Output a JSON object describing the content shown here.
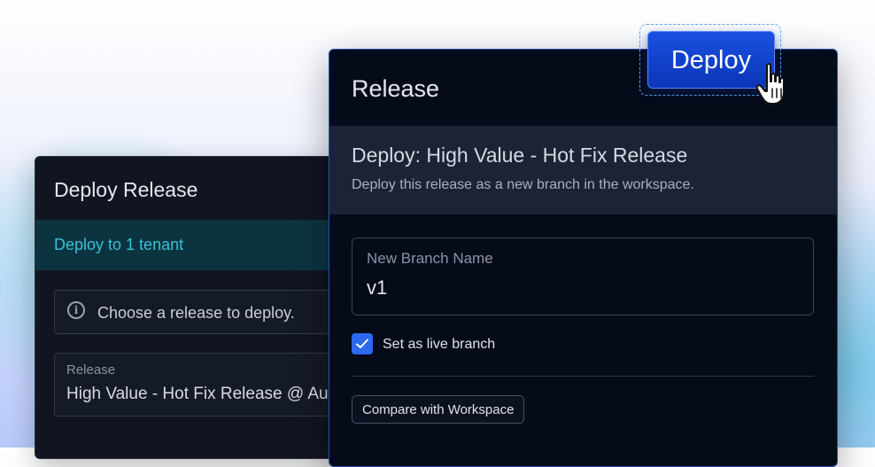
{
  "back_panel": {
    "title": "Deploy Release",
    "tenant_band": "Deploy to 1 tenant",
    "info_text": "Choose a release to deploy.",
    "release_label": "Release",
    "release_value": "High Value - Hot Fix Release @ Aug"
  },
  "front_panel": {
    "title": "Release",
    "heading": "Deploy: High Value - Hot Fix Release",
    "subheading": "Deploy this release as a new branch in the workspace.",
    "branch_label": "New Branch Name",
    "branch_value": "v1",
    "live_branch_label": "Set as live branch",
    "live_branch_checked": true,
    "compare_button": "Compare with Workspace"
  },
  "deploy_button": "Deploy",
  "colors": {
    "accent_blue": "#1a50e0",
    "tenant_text": "#39c0d8",
    "panel_bg": "#060b1a"
  }
}
